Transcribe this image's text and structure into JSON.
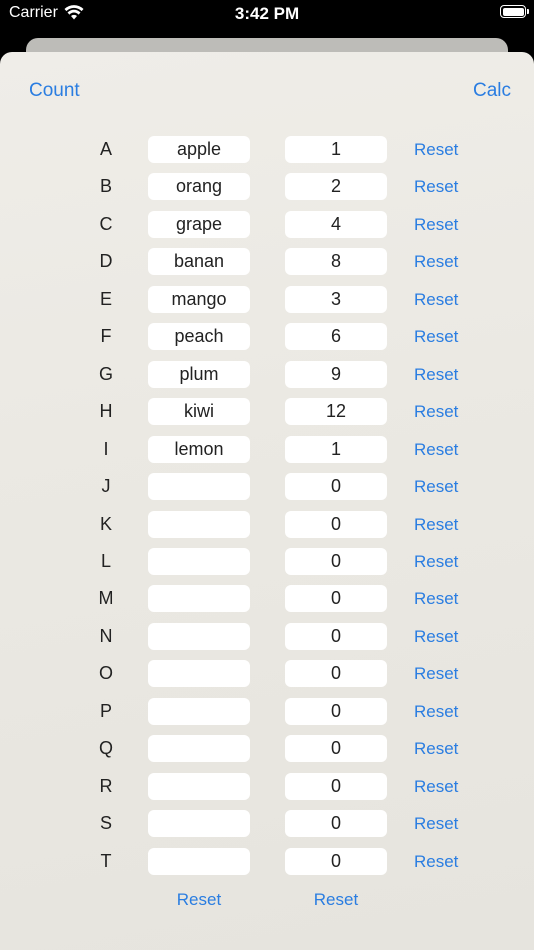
{
  "status_bar": {
    "carrier": "Carrier",
    "time": "3:42 PM",
    "wifi_icon": "wifi-icon",
    "battery_icon": "battery-icon"
  },
  "nav": {
    "left_label": "Count",
    "right_label": "Calc"
  },
  "accent_color": "#2a7de1",
  "rows": [
    {
      "letter": "A",
      "name": "apple",
      "count": "1",
      "reset_label": "Reset"
    },
    {
      "letter": "B",
      "name": "orang",
      "count": "2",
      "reset_label": "Reset"
    },
    {
      "letter": "C",
      "name": "grape",
      "count": "4",
      "reset_label": "Reset"
    },
    {
      "letter": "D",
      "name": "banan",
      "count": "8",
      "reset_label": "Reset"
    },
    {
      "letter": "E",
      "name": "mango",
      "count": "3",
      "reset_label": "Reset"
    },
    {
      "letter": "F",
      "name": "peach",
      "count": "6",
      "reset_label": "Reset"
    },
    {
      "letter": "G",
      "name": "plum",
      "count": "9",
      "reset_label": "Reset"
    },
    {
      "letter": "H",
      "name": "kiwi",
      "count": "12",
      "reset_label": "Reset"
    },
    {
      "letter": "I",
      "name": "lemon",
      "count": "1",
      "reset_label": "Reset"
    },
    {
      "letter": "J",
      "name": "",
      "count": "0",
      "reset_label": "Reset"
    },
    {
      "letter": "K",
      "name": "",
      "count": "0",
      "reset_label": "Reset"
    },
    {
      "letter": "L",
      "name": "",
      "count": "0",
      "reset_label": "Reset"
    },
    {
      "letter": "M",
      "name": "",
      "count": "0",
      "reset_label": "Reset"
    },
    {
      "letter": "N",
      "name": "",
      "count": "0",
      "reset_label": "Reset"
    },
    {
      "letter": "O",
      "name": "",
      "count": "0",
      "reset_label": "Reset"
    },
    {
      "letter": "P",
      "name": "",
      "count": "0",
      "reset_label": "Reset"
    },
    {
      "letter": "Q",
      "name": "",
      "count": "0",
      "reset_label": "Reset"
    },
    {
      "letter": "R",
      "name": "",
      "count": "0",
      "reset_label": "Reset"
    },
    {
      "letter": "S",
      "name": "",
      "count": "0",
      "reset_label": "Reset"
    },
    {
      "letter": "T",
      "name": "",
      "count": "0",
      "reset_label": "Reset"
    }
  ],
  "footer": {
    "reset_names_label": "Reset",
    "reset_counts_label": "Reset"
  }
}
